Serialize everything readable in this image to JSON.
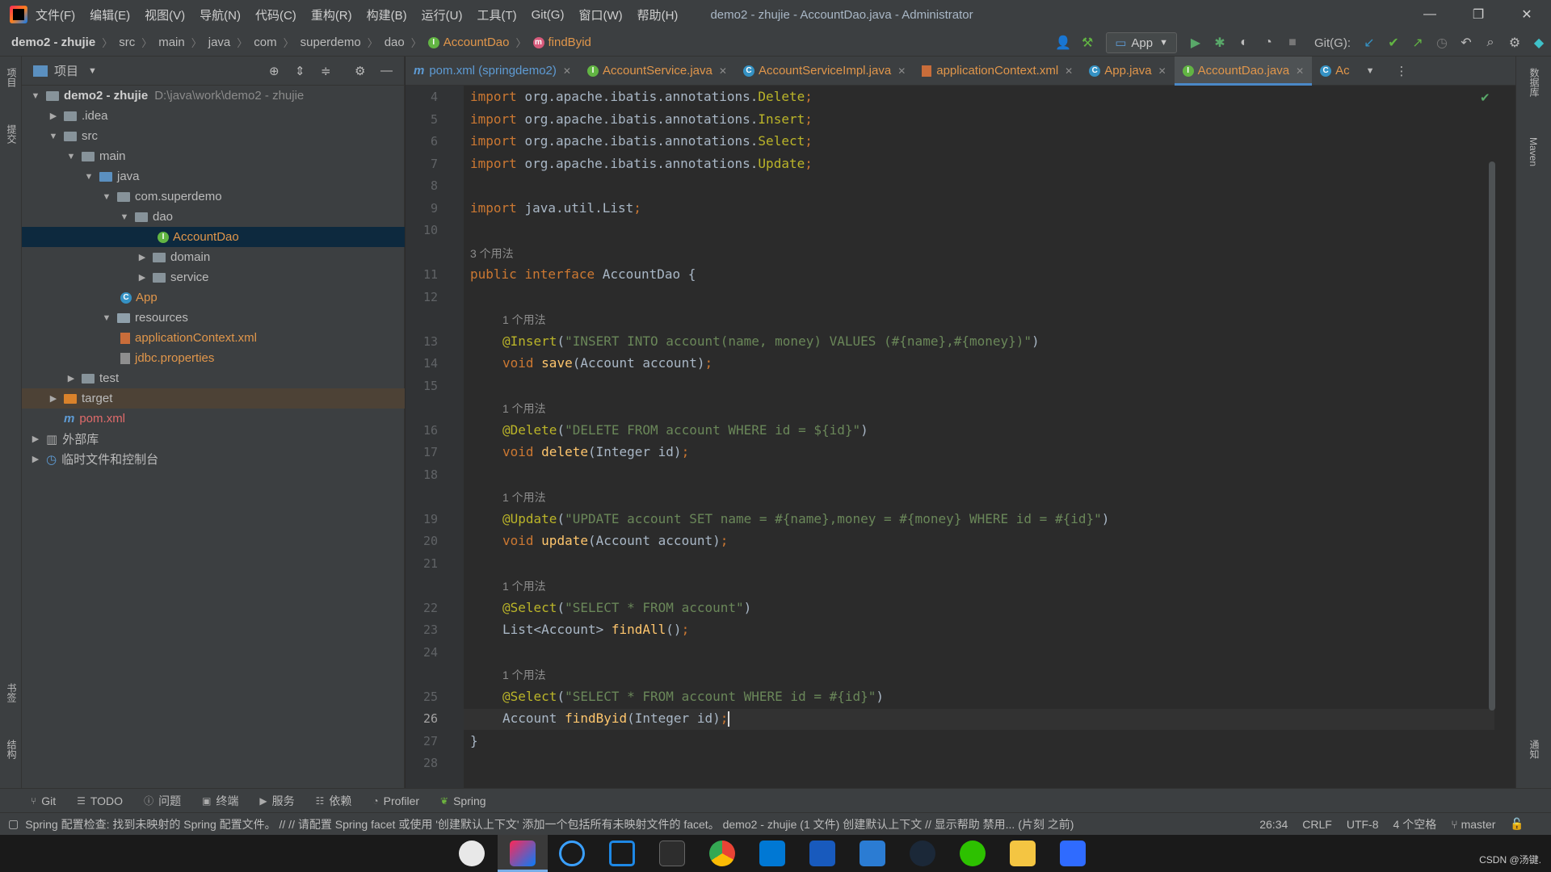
{
  "window": {
    "title": "demo2 - zhujie - AccountDao.java - Administrator",
    "menus": [
      "文件(F)",
      "编辑(E)",
      "视图(V)",
      "导航(N)",
      "代码(C)",
      "重构(R)",
      "构建(B)",
      "运行(U)",
      "工具(T)",
      "Git(G)",
      "窗口(W)",
      "帮助(H)"
    ]
  },
  "breadcrumb": {
    "project": "demo2 - zhujie",
    "items": [
      "src",
      "main",
      "java",
      "com",
      "superdemo",
      "dao"
    ],
    "class": "AccountDao",
    "method": "findByid"
  },
  "toolbar": {
    "run_config": "App",
    "git_label": "Git(G):"
  },
  "left_stripe": {
    "top_label": "项目",
    "second_label": "提交",
    "bookmarks_label": "书签",
    "structure_label": "结构"
  },
  "right_stripe": {
    "database_label": "数据库",
    "maven_label": "Maven",
    "notifications_label": "通知"
  },
  "project_panel": {
    "title": "项目",
    "tree": [
      {
        "label": "demo2 - zhujie",
        "hint": "D:\\java\\work\\demo2 - zhujie"
      },
      {
        "label": ".idea"
      },
      {
        "label": "src"
      },
      {
        "label": "main"
      },
      {
        "label": "java"
      },
      {
        "label": "com.superdemo"
      },
      {
        "label": "dao"
      },
      {
        "label": "AccountDao"
      },
      {
        "label": "domain"
      },
      {
        "label": "service"
      },
      {
        "label": "App"
      },
      {
        "label": "resources"
      },
      {
        "label": "applicationContext.xml"
      },
      {
        "label": "jdbc.properties"
      },
      {
        "label": "test"
      },
      {
        "label": "target"
      },
      {
        "label": "pom.xml"
      },
      {
        "label": "外部库"
      },
      {
        "label": "临时文件和控制台"
      }
    ]
  },
  "tabs": [
    {
      "label": "pom.xml (springdemo2)"
    },
    {
      "label": "AccountService.java"
    },
    {
      "label": "AccountServiceImpl.java"
    },
    {
      "label": "applicationContext.xml"
    },
    {
      "label": "App.java"
    },
    {
      "label": "AccountDao.java"
    },
    {
      "label": "Ac"
    }
  ],
  "editor": {
    "line_numbers": [
      "4",
      "5",
      "6",
      "7",
      "8",
      "9",
      "10",
      "11",
      "12",
      "13",
      "14",
      "15",
      "16",
      "17",
      "18",
      "19",
      "20",
      "21",
      "22",
      "23",
      "24",
      "25",
      "26",
      "27",
      "28"
    ],
    "usage_hints": [
      "3 个用法",
      "1 个用法",
      "1 个用法",
      "1 个用法",
      "1 个用法",
      "1 个用法"
    ],
    "code": {
      "import_kw": "import",
      "imp_delete": "org.apache.ibatis.annotations.",
      "delete_cls": "Delete",
      "insert_cls": "Insert",
      "select_cls": "Select",
      "update_cls": "Update",
      "java_util": "java.util.List",
      "semi": ";",
      "public_kw": "public",
      "interface_kw": "interface",
      "iface_name": "AccountDao {",
      "ann_insert": "@Insert",
      "sql_insert": "\"INSERT INTO account(name, money) VALUES (#{name},#{money})\"",
      "void_kw": "void",
      "save_fn": "save",
      "save_args": "(Account account)",
      "ann_delete": "@Delete",
      "sql_delete": "\"DELETE FROM account WHERE id = ${id}\"",
      "delete_fn": "delete",
      "delete_args": "(Integer id)",
      "ann_update": "@Update",
      "sql_update": "\"UPDATE account SET name = #{name},money = #{money} WHERE id = #{id}\"",
      "update_fn": "update",
      "update_args": "(Account account)",
      "ann_select": "@Select",
      "sql_select_all": "\"SELECT * FROM account\"",
      "list_type": "List<Account> ",
      "findall_fn": "findAll",
      "empty_args": "()",
      "sql_select_id": "\"SELECT * FROM account WHERE id = #{id}\"",
      "account_type": "Account ",
      "findbyid_fn": "findByid",
      "findbyid_args": "(Integer id)",
      "close_brace": "}",
      "lparen": "(",
      "rparen": ")"
    }
  },
  "tool_windows": [
    "Git",
    "TODO",
    "问题",
    "终端",
    "服务",
    "依赖",
    "Profiler",
    "Spring"
  ],
  "status": {
    "message": "Spring 配置检查: 找到未映射的 Spring 配置文件。 // // 请配置 Spring facet 或使用 '创建默认上下文' 添加一个包括所有未映射文件的 facet。 demo2 - zhujie (1 文件)  创建默认上下文 // 显示帮助  禁用... (片刻 之前)",
    "position": "26:34",
    "line_sep": "CRLF",
    "encoding": "UTF-8",
    "indent": "4 个空格",
    "branch": "master"
  },
  "taskbar": {
    "watermark": "CSDN @汤键."
  }
}
